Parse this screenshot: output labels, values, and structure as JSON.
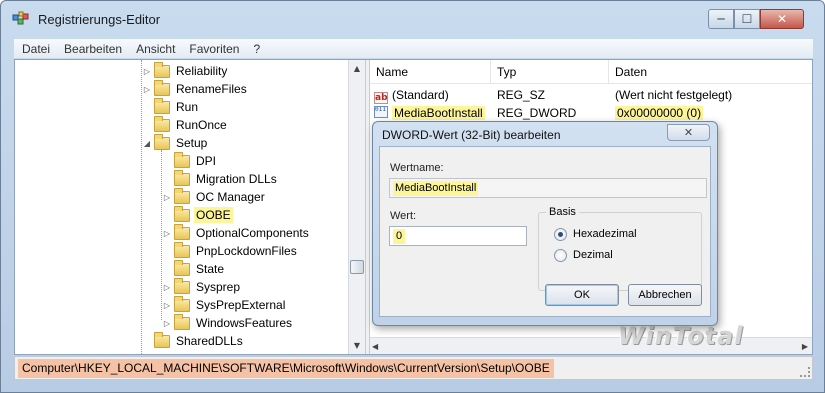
{
  "window": {
    "title": "Registrierungs-Editor",
    "min_glyph": "─",
    "max_glyph": "☐",
    "close_glyph": "✕",
    "icon": "registry-editor-icon"
  },
  "menu": [
    "Datei",
    "Bearbeiten",
    "Ansicht",
    "Favoriten",
    "?"
  ],
  "tree": {
    "items": [
      {
        "label": "Reliability",
        "expander": "▷",
        "level": 0
      },
      {
        "label": "RenameFiles",
        "expander": "▷",
        "level": 0
      },
      {
        "label": "Run",
        "expander": "",
        "level": 0
      },
      {
        "label": "RunOnce",
        "expander": "",
        "level": 0
      },
      {
        "label": "Setup",
        "expander": "◢",
        "level": 0
      },
      {
        "label": "DPI",
        "expander": "",
        "level": 1
      },
      {
        "label": "Migration DLLs",
        "expander": "",
        "level": 1
      },
      {
        "label": "OC Manager",
        "expander": "▷",
        "level": 1
      },
      {
        "label": "OOBE",
        "expander": "",
        "level": 1,
        "selected": true
      },
      {
        "label": "OptionalComponents",
        "expander": "▷",
        "level": 1
      },
      {
        "label": "PnpLockdownFiles",
        "expander": "",
        "level": 1
      },
      {
        "label": "State",
        "expander": "",
        "level": 1
      },
      {
        "label": "Sysprep",
        "expander": "▷",
        "level": 1
      },
      {
        "label": "SysPrepExternal",
        "expander": "▷",
        "level": 1
      },
      {
        "label": "WindowsFeatures",
        "expander": "▷",
        "level": 1
      },
      {
        "label": "SharedDLLs",
        "expander": "",
        "level": 0
      }
    ],
    "scroll_up": "▲",
    "scroll_down": "▼"
  },
  "list": {
    "columns": [
      "Name",
      "Typ",
      "Daten"
    ],
    "rows": [
      {
        "icon": "ab",
        "icon_name": "string-value-icon",
        "name": "(Standard)",
        "type": "REG_SZ",
        "data": "(Wert nicht festgelegt)",
        "highlight": false
      },
      {
        "icon": "011 110",
        "icon_name": "binary-value-icon",
        "name": "MediaBootInstall",
        "type": "REG_DWORD",
        "data": "0x00000000 (0)",
        "highlight": true
      }
    ],
    "hscroll_left": "◀",
    "hscroll_right": "▶"
  },
  "status": {
    "path": "Computer\\HKEY_LOCAL_MACHINE\\SOFTWARE\\Microsoft\\Windows\\CurrentVersion\\Setup\\OOBE"
  },
  "dialog": {
    "title": "DWORD-Wert (32-Bit) bearbeiten",
    "close_glyph": "✕",
    "name_label": "Wertname:",
    "name_value": "MediaBootInstall",
    "value_label": "Wert:",
    "value": "0",
    "basis_label": "Basis",
    "radio_hex": "Hexadezimal",
    "radio_dec": "Dezimal",
    "selected_basis": "Hexadezimal",
    "ok": "OK",
    "cancel": "Abbrechen"
  },
  "watermark": "WinTotal",
  "colors": {
    "highlight": "#fdf59a",
    "status_path_bg": "#f6c2a6",
    "folder": "#e8c556"
  }
}
